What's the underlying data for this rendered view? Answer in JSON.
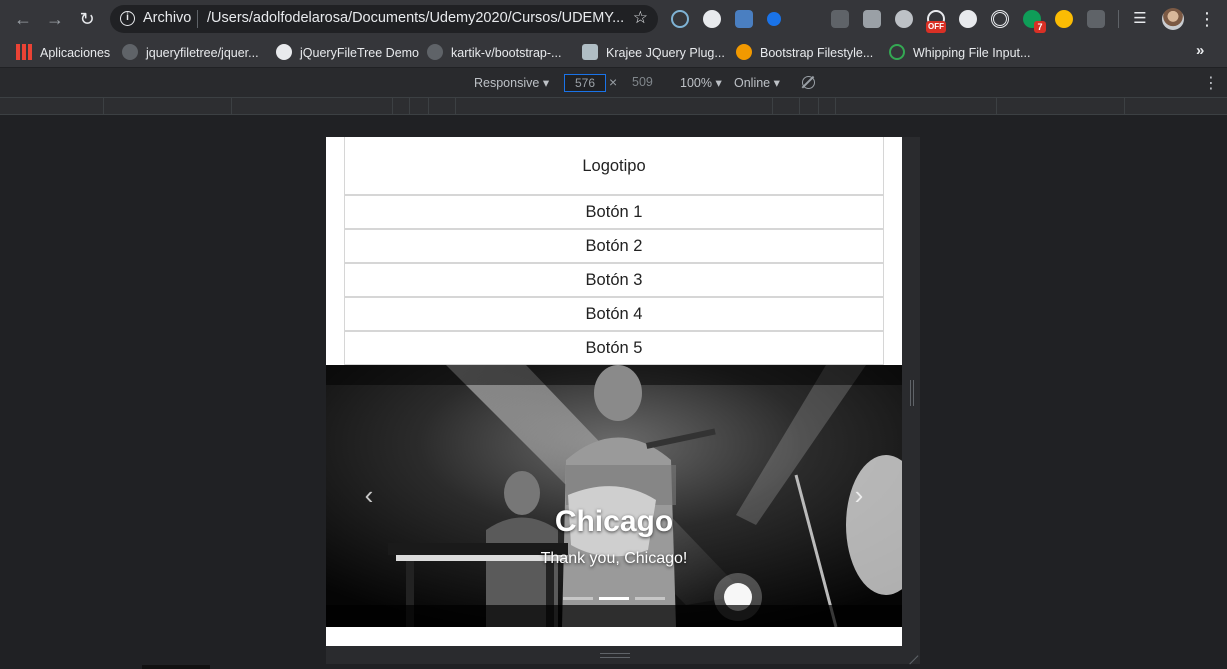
{
  "browser": {
    "address": {
      "scheme_label": "Archivo",
      "url": "/Users/adolfodelarosa/Documents/Udemy2020/Cursos/UDEMY..."
    },
    "extension_badge": "7",
    "extension_off_label": "OFF"
  },
  "bookmarks": {
    "items": [
      {
        "label": "Aplicaciones",
        "icon": "apps-grid-icon"
      },
      {
        "label": "jqueryfiletree/jquer...",
        "icon": "github-icon"
      },
      {
        "label": "jQueryFileTree Demo",
        "icon": "globe-icon"
      },
      {
        "label": "kartik-v/bootstrap-...",
        "icon": "github-icon"
      },
      {
        "label": "Krajee JQuery Plug...",
        "icon": "krajee-k-icon"
      },
      {
        "label": "Bootstrap Filestyle...",
        "icon": "orange-icon"
      },
      {
        "label": "Whipping File Input...",
        "icon": "leaf-icon"
      }
    ],
    "more_label": "»"
  },
  "device_toolbar": {
    "device": "Responsive",
    "width": "576",
    "height": "509",
    "times": "×",
    "zoom": "100%",
    "network": "Online"
  },
  "page": {
    "logo_text": "Logotipo",
    "buttons": [
      "Botón 1",
      "Botón 2",
      "Botón 3",
      "Botón 4",
      "Botón 5"
    ],
    "carousel": {
      "title": "Chicago",
      "subtitle": "Thank you, Chicago!",
      "prev_glyph": "‹",
      "next_glyph": "›",
      "active_index": 1,
      "slide_count": 3
    }
  },
  "colors": {
    "chrome_bg": "#35363a",
    "devtools_bg": "#292a2d",
    "canvas_bg": "#202124",
    "focus_blue": "#1a73e8"
  }
}
